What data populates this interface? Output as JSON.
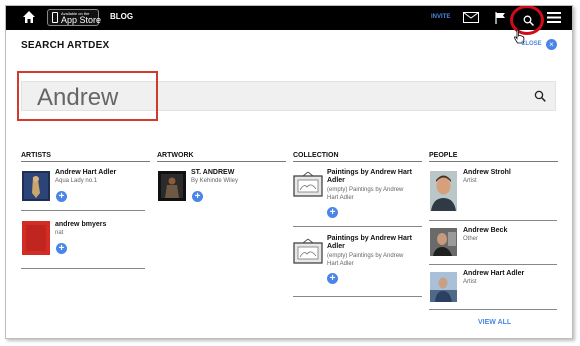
{
  "topbar": {
    "appstore_small": "Available on the",
    "appstore_big": "App Store",
    "blog": "BLOG",
    "invite": "INVITE"
  },
  "page": {
    "title": "SEARCH ARTDEX",
    "close": "CLOSE"
  },
  "search": {
    "query": "Andrew"
  },
  "columns": {
    "artists": "ARTISTS",
    "artwork": "ARTWORK",
    "collection": "COLLECTION",
    "people": "PEOPLE"
  },
  "artists": [
    {
      "name": "Andrew Hart Adler",
      "sub": "Aqua Lady no.1"
    },
    {
      "name": "andrew bmyers",
      "sub": "nat"
    }
  ],
  "artwork": [
    {
      "name": "ST. ANDREW",
      "sub": "By Kehinde Wiley"
    }
  ],
  "collection": [
    {
      "name1": "Paintings by Andrew Hart",
      "name2": "Adler",
      "sub1": "(empty) Paintings by Andrew",
      "sub2": "Hart Adler"
    },
    {
      "name1": "Paintings by Andrew Hart",
      "name2": "Adler",
      "sub1": "(empty) Paintings by Andrew",
      "sub2": "Hart Adler"
    }
  ],
  "people": [
    {
      "name": "Andrew Strohl",
      "sub": "Artist"
    },
    {
      "name": "Andrew Beck",
      "sub": "Other"
    },
    {
      "name": "Andrew Hart Adler",
      "sub": "Artist"
    }
  ],
  "view_all": "VIEW ALL",
  "colors": {
    "accent": "#4a86e8",
    "highlight": "#d00c1a",
    "bar": "#000000"
  }
}
